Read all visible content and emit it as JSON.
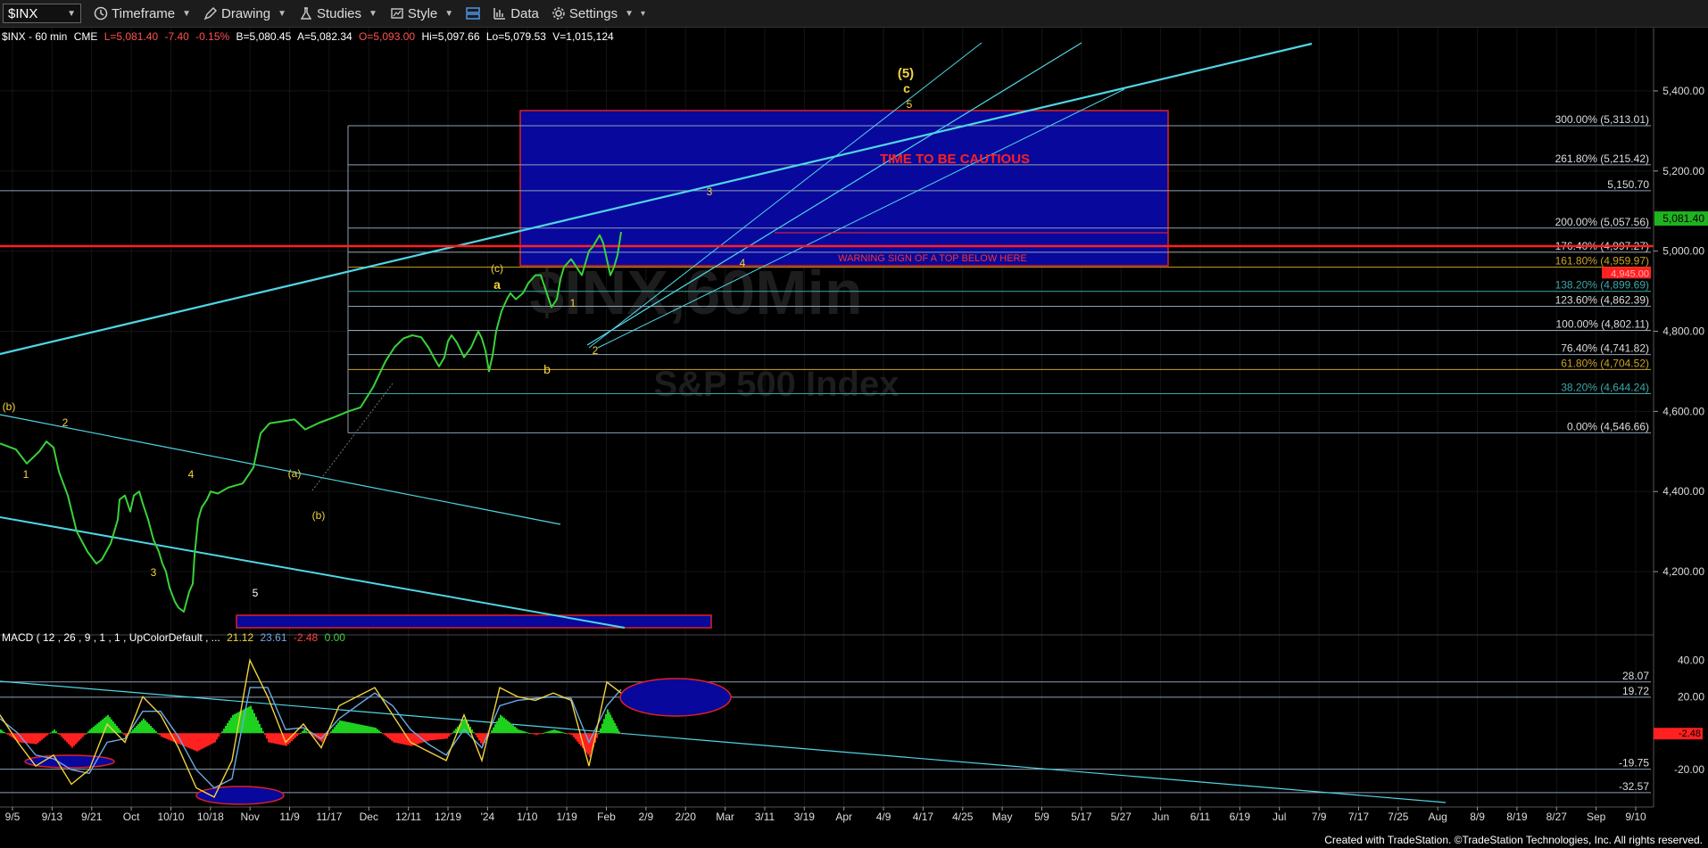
{
  "toolbar": {
    "symbol": "$INX",
    "timeframe": "Timeframe",
    "drawing": "Drawing",
    "studies": "Studies",
    "style": "Style",
    "data": "Data",
    "settings": "Settings"
  },
  "header": {
    "symbol": "$INX - 60 min",
    "exchange": "CME",
    "last": "L=5,081.40",
    "change": "-7.40",
    "pct": "-0.15%",
    "bid": "B=5,080.45",
    "ask": "A=5,082.34",
    "open": "O=5,093.00",
    "high": "Hi=5,097.66",
    "low": "Lo=5,079.53",
    "volume": "V=1,015,124"
  },
  "colors": {
    "price": "#39d23a",
    "fib": "#8fa0b5",
    "trend": "#4fd6e6",
    "box": "#0a0a9a",
    "red": "#ff2020",
    "label": "#f2d33b"
  },
  "chart_data": [
    {
      "type": "line",
      "title": "",
      "watermark": [
        "$INX,60Min",
        "S&P 500 Index"
      ],
      "ylim": [
        4060,
        5520
      ],
      "x_ticks": [
        "9/5",
        "9/13",
        "9/21",
        "Oct",
        "10/10",
        "10/18",
        "Nov",
        "11/9",
        "11/17",
        "Dec",
        "12/11",
        "12/19",
        "'24",
        "1/10",
        "1/19",
        "Feb",
        "2/9",
        "2/20",
        "Mar",
        "3/11",
        "3/19",
        "Apr",
        "4/9",
        "4/17",
        "4/25",
        "May",
        "5/9",
        "5/17",
        "5/27",
        "Jun",
        "6/11",
        "6/19",
        "Jul",
        "7/9",
        "7/17",
        "7/25",
        "Aug",
        "8/9",
        "8/19",
        "8/27",
        "Sep",
        "9/10"
      ],
      "y_ticks": [
        "5,400.00",
        "5,200.00",
        "5,000.00",
        "4,800.00",
        "4,600.00",
        "4,400.00",
        "4,200.00"
      ],
      "y_tick_values": [
        5400,
        5200,
        5000,
        4800,
        4600,
        4400,
        4200
      ],
      "series": [
        {
          "color": "#39d23a",
          "x": [
            0,
            18,
            30,
            44,
            52,
            60,
            66,
            76,
            86,
            98,
            108,
            114,
            124,
            128,
            132,
            134,
            140,
            146,
            150,
            156,
            160,
            166,
            172,
            178,
            182,
            186,
            190,
            196,
            200,
            206,
            212,
            216,
            218,
            222,
            226,
            232,
            236,
            244,
            256,
            272,
            284,
            292,
            302,
            316,
            330,
            342,
            358,
            374,
            390,
            404,
            418,
            432,
            442,
            452,
            462,
            472,
            480,
            486,
            492,
            498,
            502,
            506,
            512,
            520,
            528,
            536,
            540,
            544,
            548,
            552,
            556,
            562,
            568,
            572,
            578,
            586,
            592,
            600,
            606,
            612,
            618,
            624,
            628,
            632,
            636,
            640,
            646,
            652,
            656,
            660,
            664,
            668,
            672,
            676,
            680,
            684,
            688,
            692,
            696
          ],
          "y": [
            4520,
            4505,
            4470,
            4500,
            4525,
            4510,
            4450,
            4390,
            4300,
            4250,
            4220,
            4230,
            4270,
            4300,
            4330,
            4380,
            4390,
            4350,
            4390,
            4400,
            4370,
            4330,
            4280,
            4250,
            4220,
            4200,
            4160,
            4125,
            4110,
            4100,
            4150,
            4170,
            4240,
            4330,
            4360,
            4380,
            4400,
            4395,
            4410,
            4420,
            4460,
            4545,
            4570,
            4575,
            4580,
            4555,
            4572,
            4585,
            4600,
            4610,
            4660,
            4725,
            4760,
            4782,
            4790,
            4785,
            4760,
            4735,
            4712,
            4735,
            4775,
            4790,
            4772,
            4735,
            4760,
            4800,
            4782,
            4752,
            4700,
            4740,
            4800,
            4850,
            4880,
            4895,
            4880,
            4895,
            4920,
            4940,
            4940,
            4900,
            4860,
            4880,
            4930,
            4960,
            4970,
            4980,
            4960,
            4940,
            4970,
            5000,
            5010,
            5025,
            5040,
            5020,
            4980,
            4940,
            4960,
            4990,
            5048
          ]
        }
      ],
      "fib_levels": [
        {
          "label": "300.00% (5,313.01)",
          "value": 5313.01
        },
        {
          "label": "261.80% (5,215.42)",
          "value": 5215.42
        },
        {
          "label": "5,150.70",
          "value": 5150.7
        },
        {
          "label": "200.00% (5,057.56)",
          "value": 5057.56
        },
        {
          "label": "176.40% (4,997.27)",
          "value": 4997.27
        },
        {
          "label": "161.80% (4,959.97)",
          "value": 4959.97
        },
        {
          "label": "138.20% (4,899.69)",
          "value": 4899.69
        },
        {
          "label": "123.60% (4,862.39)",
          "value": 4862.39
        },
        {
          "label": "100.00% (4,802.11)",
          "value": 4802.11
        },
        {
          "label": "76.40% (4,741.82)",
          "value": 4741.82
        },
        {
          "label": "61.80% (4,704.52)",
          "value": 4704.52
        },
        {
          "label": "38.20% (4,644.24)",
          "value": 4644.24
        },
        {
          "label": "0.00% (4,546.66)",
          "value": 4546.66
        }
      ],
      "last_price_tag": "5,081.40",
      "red_level_tag": "4,945.00",
      "annotations": {
        "caution": "TIME TO BE CAUTIOUS",
        "warning": "WARNING SIGN OF A TOP BELOW HERE",
        "waves": [
          "(5)",
          "c",
          "5",
          "3",
          "a",
          "(c)",
          "1",
          "4",
          "2",
          "b",
          "(b)",
          "2",
          "1",
          "4",
          "3",
          "5",
          "(a)",
          "(b)"
        ]
      }
    },
    {
      "type": "line",
      "title": "MACD ( 12 , 26 , 9 , 1 , 1 , UpColorDefault , ...",
      "readout": [
        "21.12",
        "23.61",
        "-2.48",
        "0.00"
      ],
      "ylim": [
        -38,
        48
      ],
      "y_ticks": [
        "40.00",
        "20.00",
        "-20.00"
      ],
      "y_tick_values": [
        40,
        20,
        -20
      ],
      "levels": [
        {
          "label": "28.07",
          "value": 28.07
        },
        {
          "label": "19.72",
          "value": 19.72
        },
        {
          "label": "-19.75",
          "value": -19.75
        },
        {
          "label": "-32.57",
          "value": -32.57
        }
      ],
      "last_tag": "-2.48",
      "series": [
        {
          "name": "MACD",
          "color": "#f2d33b",
          "x": [
            0,
            20,
            40,
            60,
            80,
            100,
            120,
            140,
            160,
            180,
            200,
            220,
            240,
            260,
            280,
            300,
            320,
            340,
            360,
            380,
            400,
            420,
            440,
            460,
            480,
            500,
            520,
            540,
            560,
            580,
            600,
            620,
            640,
            660,
            680,
            696
          ],
          "y": [
            10,
            -5,
            -18,
            -12,
            -28,
            -20,
            5,
            -5,
            20,
            10,
            -8,
            -30,
            -35,
            -15,
            40,
            20,
            -5,
            5,
            -8,
            15,
            20,
            25,
            10,
            -5,
            -10,
            -15,
            10,
            -15,
            25,
            20,
            18,
            22,
            18,
            -18,
            28,
            22
          ]
        },
        {
          "name": "Signal",
          "color": "#6aa9e6",
          "x": [
            0,
            20,
            40,
            60,
            80,
            100,
            120,
            140,
            160,
            180,
            200,
            220,
            240,
            260,
            280,
            300,
            320,
            340,
            360,
            380,
            400,
            420,
            440,
            460,
            480,
            500,
            520,
            540,
            560,
            580,
            600,
            620,
            640,
            660,
            680,
            696
          ],
          "y": [
            8,
            0,
            -12,
            -14,
            -20,
            -22,
            -5,
            -3,
            12,
            12,
            -2,
            -20,
            -30,
            -25,
            25,
            25,
            2,
            3,
            -3,
            8,
            15,
            22,
            15,
            2,
            -6,
            -12,
            2,
            -8,
            15,
            18,
            19,
            20,
            19,
            -5,
            15,
            24
          ]
        },
        {
          "name": "Histogram",
          "x": [
            0,
            20,
            40,
            60,
            80,
            100,
            120,
            140,
            160,
            180,
            200,
            220,
            240,
            260,
            280,
            300,
            320,
            340,
            360,
            380,
            400,
            420,
            440,
            460,
            480,
            500,
            520,
            540,
            560,
            580,
            600,
            620,
            640,
            660,
            680,
            696
          ],
          "y": [
            2,
            -5,
            -6,
            2,
            -8,
            2,
            10,
            -2,
            8,
            -2,
            -6,
            -10,
            -5,
            10,
            15,
            -5,
            -7,
            2,
            -5,
            7,
            5,
            3,
            -5,
            -7,
            -4,
            -3,
            8,
            -7,
            10,
            2,
            -1,
            2,
            -1,
            -13,
            13,
            -2
          ]
        }
      ]
    }
  ],
  "footer": "Created with TradeStation. ©TradeStation Technologies, Inc. All rights reserved."
}
